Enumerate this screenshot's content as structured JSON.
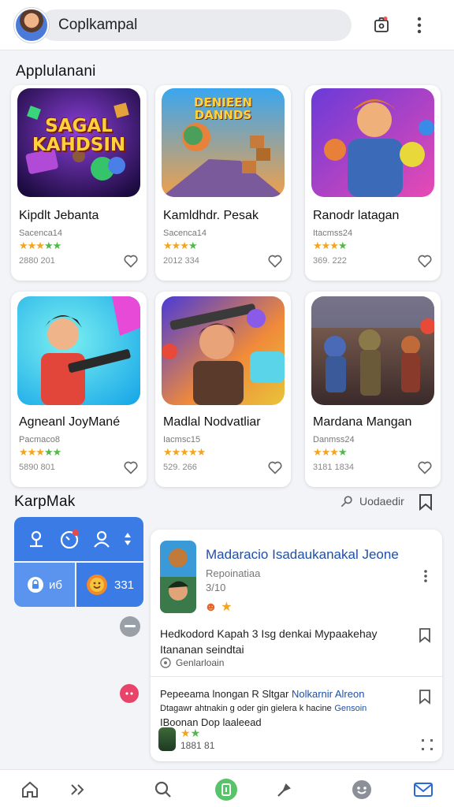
{
  "topbar": {
    "search_text": "Coplkampal",
    "avatar": "user-avatar",
    "icons": [
      "camera-icon",
      "more-vertical-icon"
    ]
  },
  "section1": {
    "title": "Applulanani",
    "apps": [
      {
        "art_title": "SAGAL KAHDSIN",
        "name": "Kipdlt Jebanta",
        "sub": "Sacenca14",
        "meta": "2880 201",
        "stars": "★★★★★"
      },
      {
        "art_title": "DENIEEN DANNDS",
        "name": "Kamldhdr. Pesak",
        "sub": "Sacenca14",
        "meta": "2012 334",
        "stars": "★★★★"
      },
      {
        "art_title": "",
        "name": "Ranodr latagan",
        "sub": "Itacmss24",
        "meta": "369. 222",
        "stars": "★★★★"
      },
      {
        "art_title": "",
        "name": "Agneanl JoyMané",
        "sub": "Pacmaco8",
        "meta": "5890 801",
        "stars": "★★★★★"
      },
      {
        "art_title": "",
        "name": "Madlal Nodvatliar",
        "sub": "Iacmsc15",
        "meta": "529. 266",
        "stars": "★★★★★"
      },
      {
        "art_title": "",
        "name": "Mardana Mangan",
        "sub": "Danmss24",
        "meta": "3181 1834",
        "stars": "★★★★"
      }
    ]
  },
  "section2": {
    "title": "KarpMak",
    "update_label": "Uodaedir",
    "panel": {
      "cell_left": "иб",
      "cell_right": "331"
    },
    "feed": {
      "title": "Madaracio Isadaukanakal Jeone",
      "sub": "Repoinatiaa",
      "meta": "3/10",
      "post1_text": "Hedkodord Kapah 3 Isg denkai Mypaakehay Itananan seindtai",
      "post1_link": "Genlarloain",
      "post2_text_a": "Pepeeama lnongan R Sltgar",
      "post2_text_accent": "Nolkarnir Alreon",
      "post2_text_b": "Dtagawr ahtnakin g oder gin gielera k hacine",
      "post2_text_accent2": "Gensoin",
      "post2_text_c": "IBoonan Dop laaleead",
      "post2_meta": "1881 81"
    }
  },
  "bottom_nav": [
    "home-icon",
    "forward-icon",
    "search-icon",
    "app-center-icon",
    "pin-icon",
    "smile-icon",
    "mail-icon"
  ],
  "colors": {
    "accent_blue": "#3a7be6",
    "star_orange": "#f4a51c",
    "star_green": "#53b84a",
    "title_blue": "#1f4fa6"
  }
}
